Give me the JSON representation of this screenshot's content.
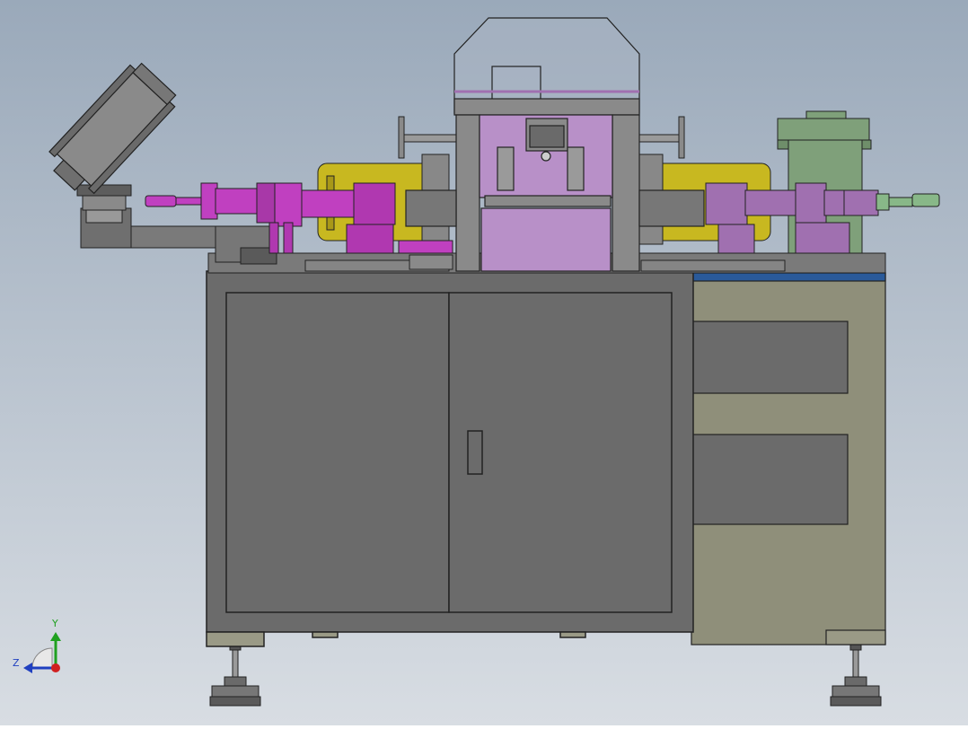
{
  "colors": {
    "bg_top": "#9aa9ba",
    "bg_bottom": "#d8dde3",
    "cabinet": "#6b6b6b",
    "outline": "#222222",
    "frame": "#8f8f7a",
    "base_plate": "#7a7a7a",
    "magenta": "#c040c0",
    "violet": "#a070b0",
    "lavender": "#b890c8",
    "yellow": "#c8b820",
    "green": "#7fa07a",
    "pale_green": "#88b888",
    "blue_strip": "#2a5a9a",
    "hood": "#a9b4c2",
    "axis_x": "#d02020",
    "axis_y": "#20a020",
    "axis_z": "#2040c0"
  },
  "triad": {
    "y_label": "Y",
    "z_label": "Z"
  }
}
